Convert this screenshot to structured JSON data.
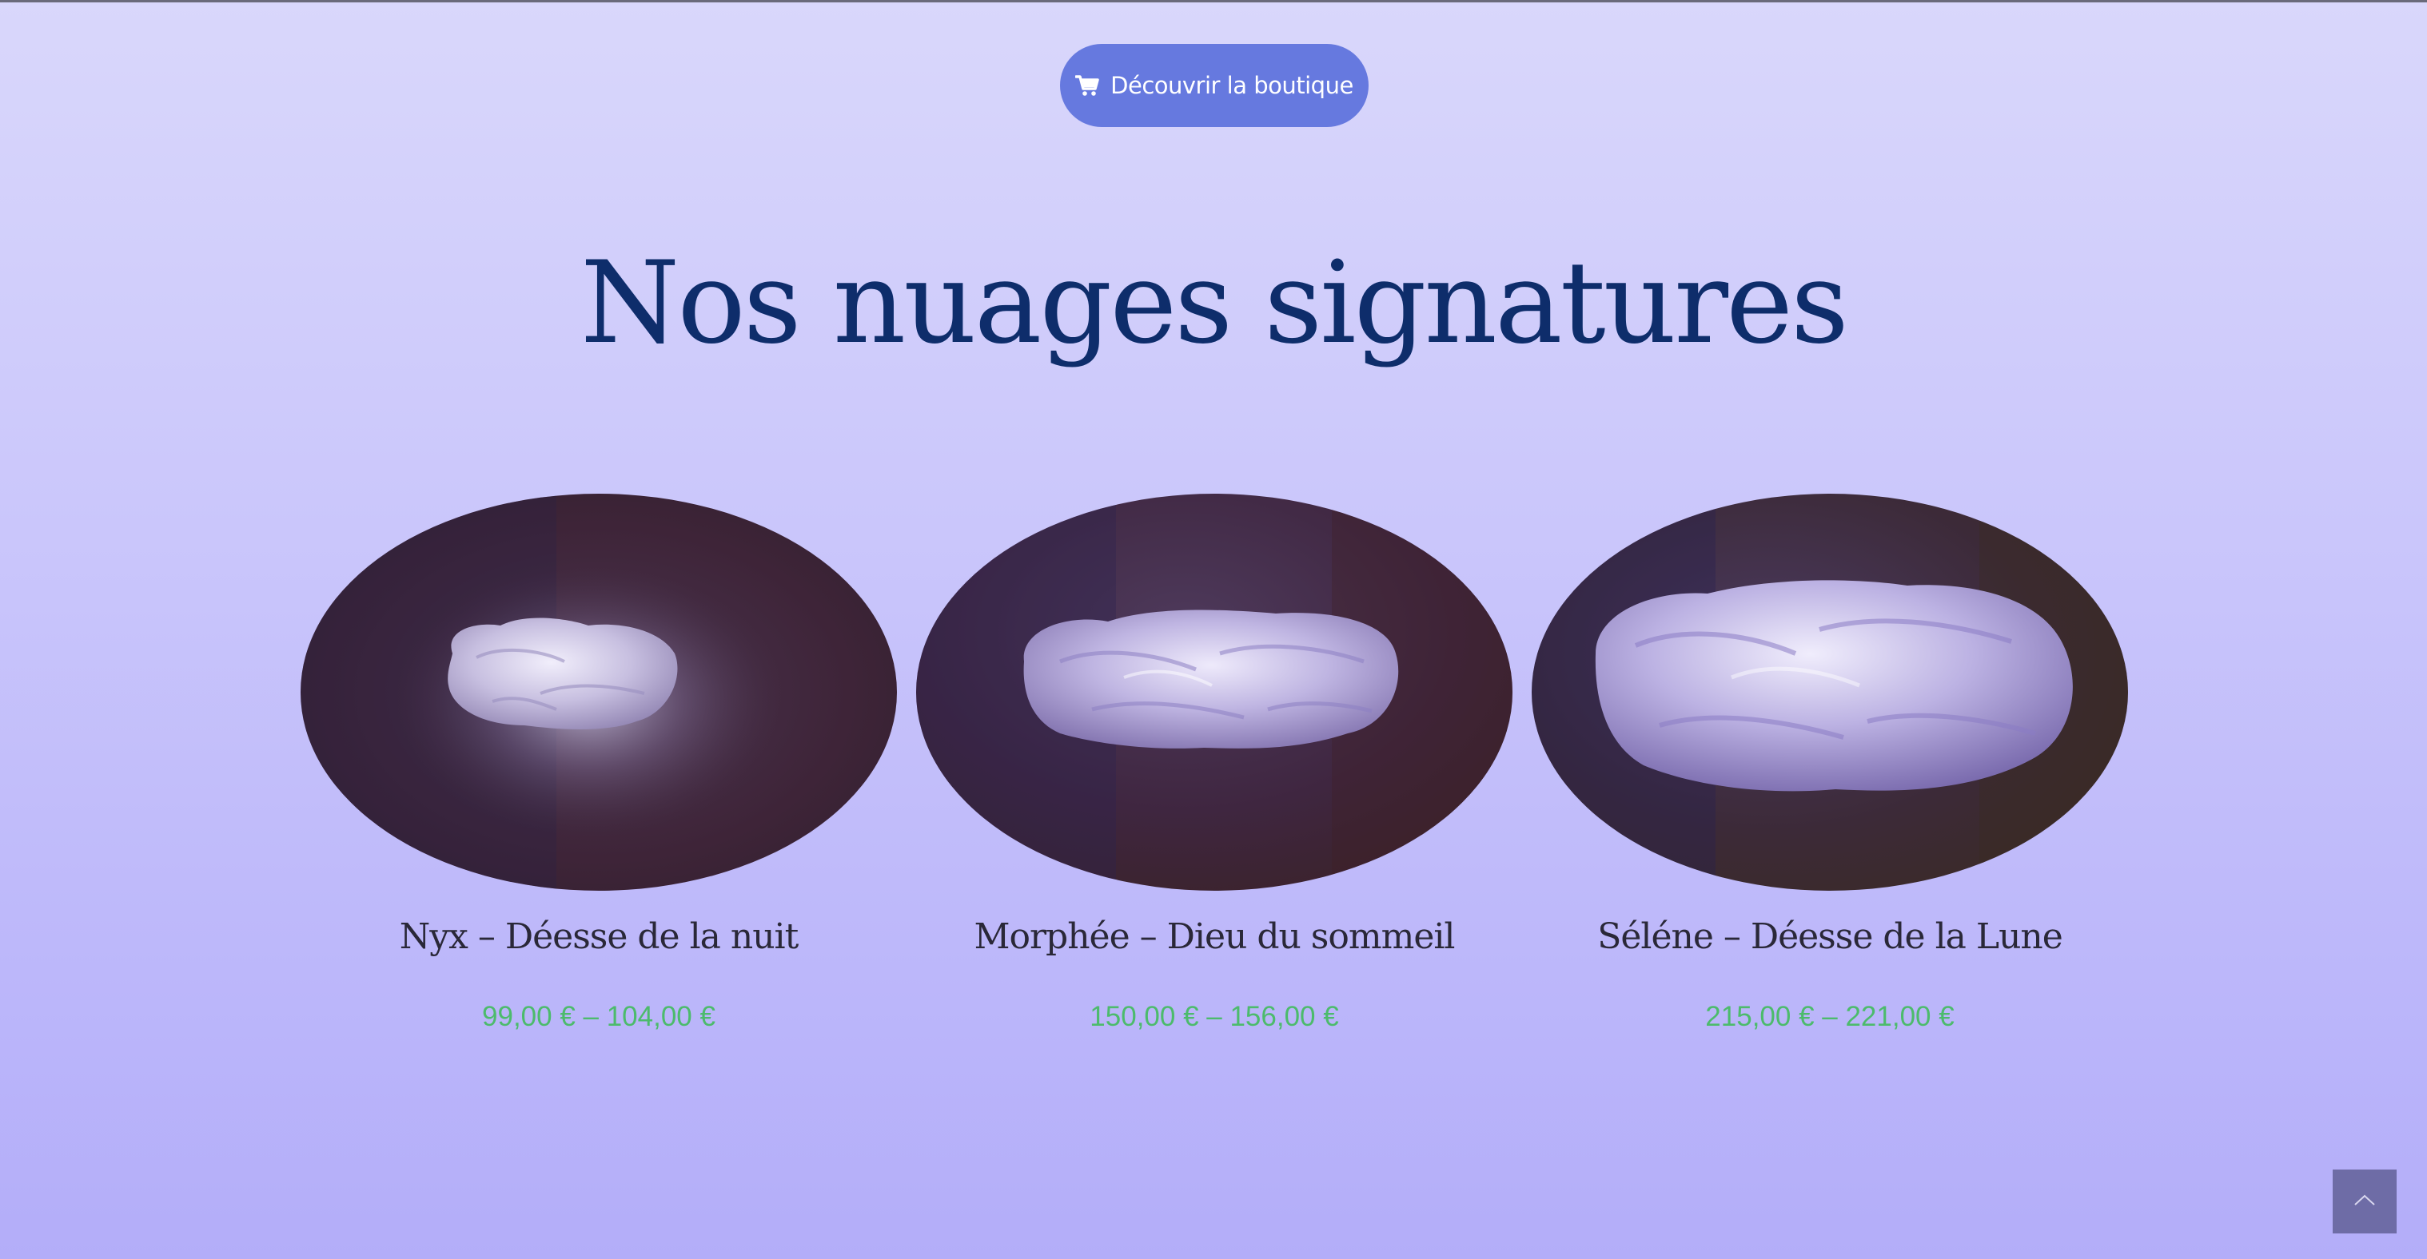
{
  "shop_button": {
    "label": "Découvrir la boutique",
    "icon": "cart-icon"
  },
  "section": {
    "title": "Nos nuages signatures"
  },
  "products": [
    {
      "name": "Nyx – Déesse de la nuit",
      "price": "99,00 € – 104,00 €"
    },
    {
      "name": "Morphée – Dieu du sommeil",
      "price": "150,00 € – 156,00 €"
    },
    {
      "name": "Séléne – Déesse de la Lune",
      "price": "215,00 € – 221,00 €"
    }
  ],
  "scroll_top": {
    "icon": "chevron-up-icon"
  },
  "colors": {
    "button": "#6679df",
    "title": "#0e2d6b",
    "price": "#4cbb6c",
    "scroll_top": "#6e6ca6"
  }
}
